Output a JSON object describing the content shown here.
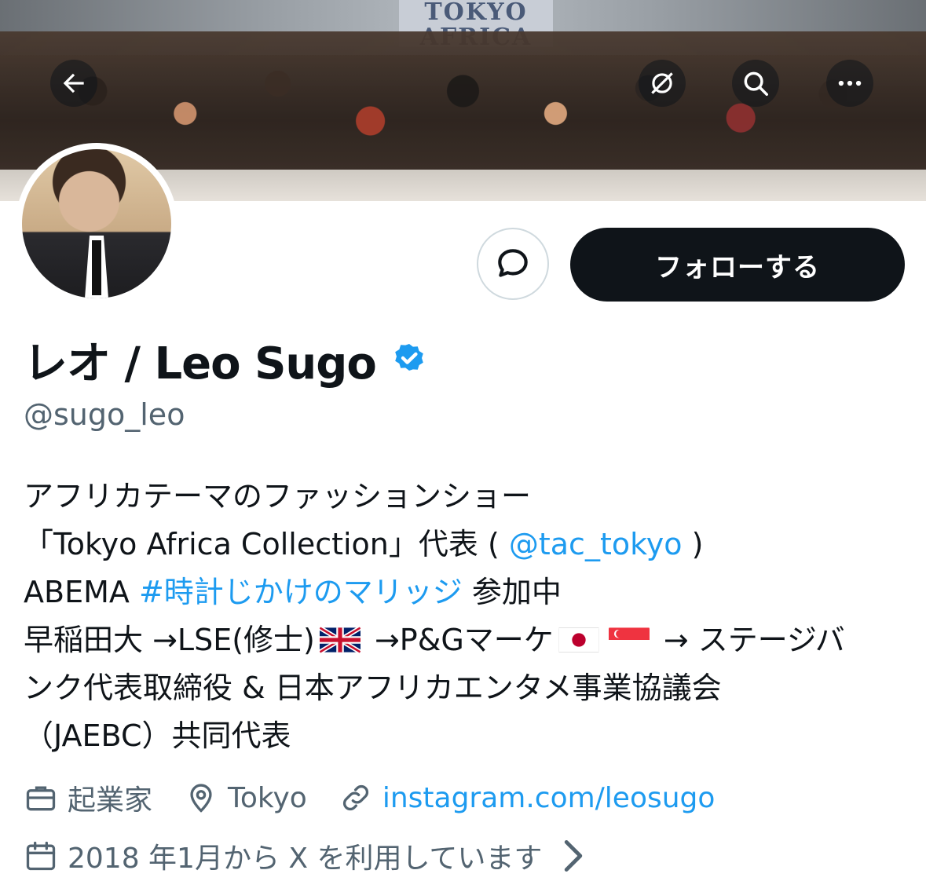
{
  "header": {
    "banner_sign_text": "TOKYO AFRICA",
    "back_label": "back",
    "grok_label": "grok",
    "search_label": "search",
    "more_label": "more"
  },
  "profile": {
    "display_name": "レオ / Leo Sugo",
    "handle": "@sugo_leo",
    "follow_label": "フォローする",
    "verified": true,
    "accent_color": "#1d9bf0"
  },
  "bio": {
    "line1": "アフリカテーマのファッションショー",
    "line2_pre": "「Tokyo Africa Collection」代表 ( ",
    "line2_mention": "@tac_tokyo",
    "line2_post": " )",
    "line3_pre": "ABEMA ",
    "line3_hashtag": "#時計じかけのマリッジ",
    "line3_post": " 参加中",
    "line4_a": "早稲田大 →LSE(修士)",
    "line4_b": " →P&Gマーケ",
    "line4_c": " → ステージバ",
    "line5": "ンク代表取締役 & 日本アフリカエンタメ事業協議会",
    "line6": "（JAEBC）共同代表"
  },
  "meta": {
    "occupation": "起業家",
    "location": "Tokyo",
    "website": "instagram.com/leosugo",
    "joined": "2018 年1月から X を利用しています"
  }
}
